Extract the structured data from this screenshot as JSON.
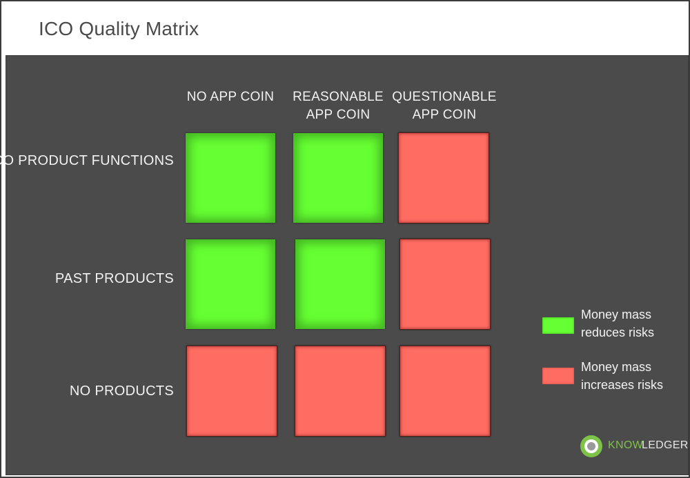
{
  "title": "ICO Quality Matrix",
  "columns": [
    {
      "line1": "NO APP COIN",
      "line2": ""
    },
    {
      "line1": "REASONABLE",
      "line2": "APP COIN"
    },
    {
      "line1": "QUESTIONABLE",
      "line2": "APP COIN"
    }
  ],
  "rows": [
    "ICO PRODUCT FUNCTIONS",
    "PAST PRODUCTS",
    "NO PRODUCTS"
  ],
  "matrix": [
    [
      "green",
      "green",
      "red"
    ],
    [
      "green",
      "green",
      "red"
    ],
    [
      "red",
      "red",
      "red"
    ]
  ],
  "legend": [
    {
      "color": "green",
      "line1": "Money mass",
      "line2": "reduces risks"
    },
    {
      "color": "red",
      "line1": "Money mass",
      "line2": "increases risks"
    }
  ],
  "colors": {
    "green": "#66ff33",
    "red": "#ff6c62",
    "panel": "#4b4b4b",
    "logo_green": "#7ec24a"
  },
  "logo": {
    "icon": "knowledger-circle-icon",
    "part1": "KNOW",
    "part2": "LEDGER"
  }
}
